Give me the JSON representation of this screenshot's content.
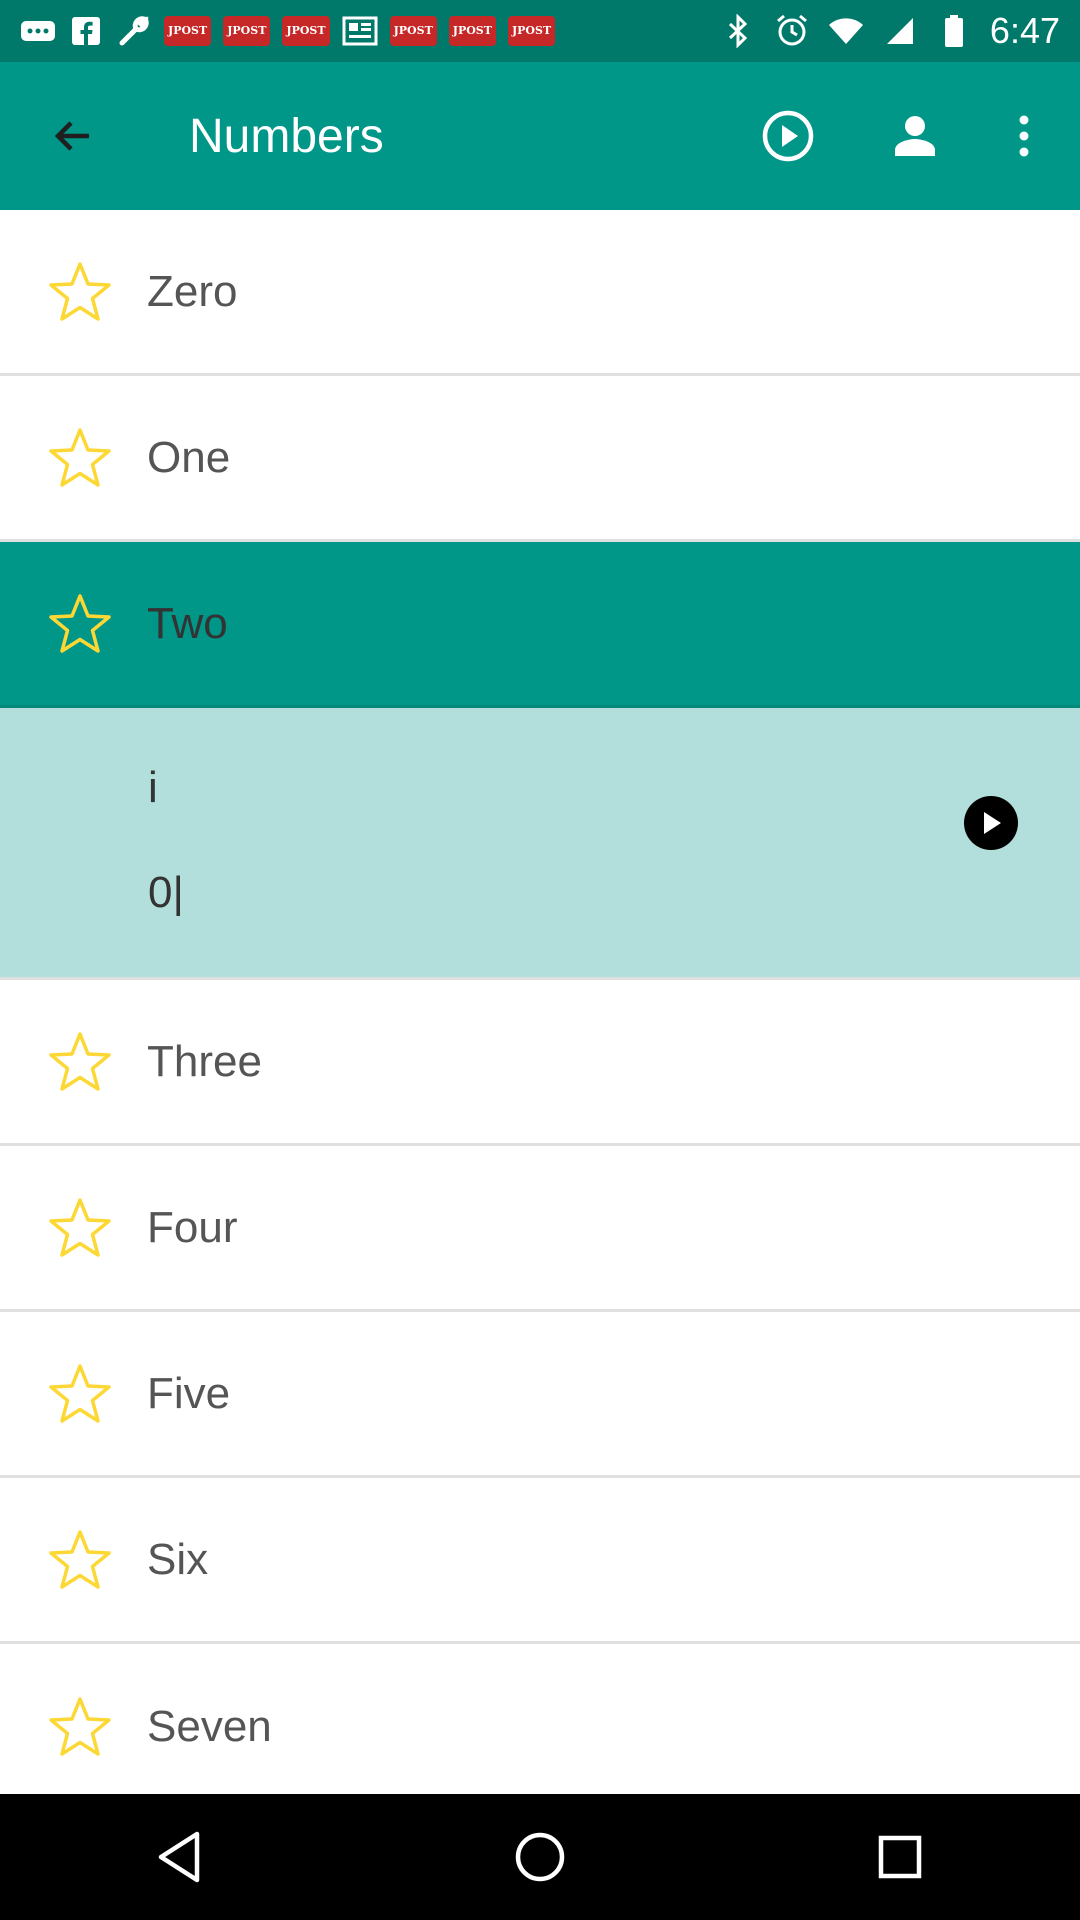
{
  "status_bar": {
    "time": "6:47",
    "notification_badges": [
      "JPOST",
      "JPOST",
      "JPOST",
      "JPOST",
      "JPOST",
      "JPOST",
      "JPOST"
    ],
    "icons": [
      "more-horiz-icon",
      "facebook-icon",
      "wrench-icon",
      "newspaper-icon",
      "bluetooth-icon",
      "alarm-icon",
      "wifi-icon",
      "signal-icon",
      "battery-icon"
    ]
  },
  "app_bar": {
    "title": "Numbers",
    "background": "#009688",
    "actions": [
      "play-circle-icon",
      "person-icon",
      "overflow-menu-icon"
    ]
  },
  "list": {
    "items_before": [
      {
        "label": "Zero"
      },
      {
        "label": "One"
      }
    ],
    "selected": {
      "label": "Two"
    },
    "detail": {
      "line1": "i",
      "line2": "0|"
    },
    "items_after": [
      {
        "label": "Three"
      },
      {
        "label": "Four"
      },
      {
        "label": "Five"
      },
      {
        "label": "Six"
      },
      {
        "label": "Seven"
      }
    ]
  },
  "colors": {
    "accent": "#009688",
    "status_bar": "#00796b",
    "detail_background": "#b2dfdb",
    "star": "#fdd835"
  },
  "nav_bar": {
    "buttons": [
      "back-triangle-icon",
      "home-circle-icon",
      "recents-square-icon"
    ]
  }
}
